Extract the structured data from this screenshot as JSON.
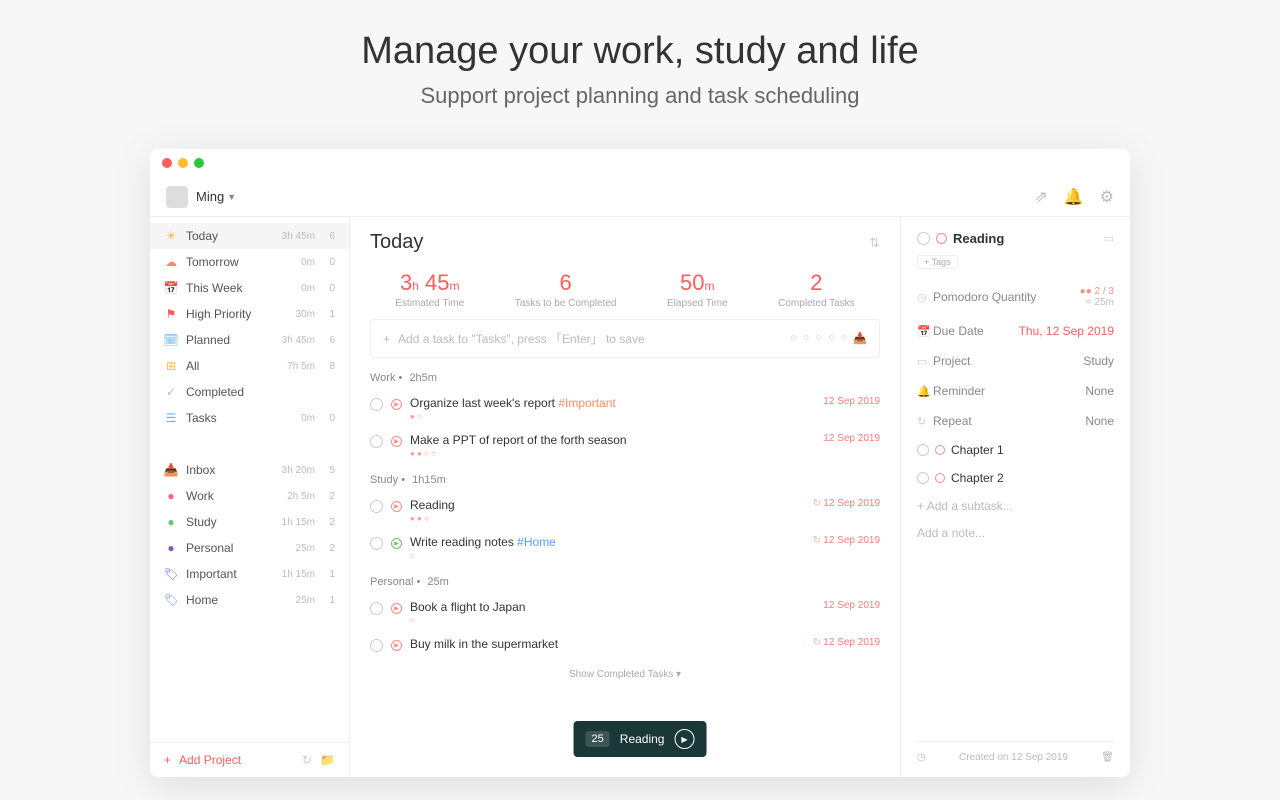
{
  "hero": {
    "title": "Manage your work, study and life",
    "subtitle": "Support project planning and task scheduling"
  },
  "topbar": {
    "username": "Ming"
  },
  "sidebar": {
    "smart": [
      {
        "icon": "☀",
        "color": "#ffb74d",
        "label": "Today",
        "meta": "3h 45m",
        "count": "6",
        "active": true
      },
      {
        "icon": "☁",
        "color": "#ff8a65",
        "label": "Tomorrow",
        "meta": "0m",
        "count": "0"
      },
      {
        "icon": "📅",
        "color": "#7986cb",
        "label": "This Week",
        "meta": "0m",
        "count": "0"
      },
      {
        "icon": "⚑",
        "color": "#ff5b5b",
        "label": "High Priority",
        "meta": "30m",
        "count": "1"
      },
      {
        "icon": "🗓",
        "color": "#64b5f6",
        "label": "Planned",
        "meta": "3h 45m",
        "count": "6"
      },
      {
        "icon": "⊞",
        "color": "#ffb74d",
        "label": "All",
        "meta": "7h 5m",
        "count": "8"
      },
      {
        "icon": "✓",
        "color": "#bbb",
        "label": "Completed",
        "meta": "",
        "count": ""
      },
      {
        "icon": "☰",
        "color": "#64b5f6",
        "label": "Tasks",
        "meta": "0m",
        "count": "0"
      }
    ],
    "projects": [
      {
        "icon": "📥",
        "color": "#bbb",
        "label": "Inbox",
        "meta": "3h 20m",
        "count": "5"
      },
      {
        "icon": "●",
        "color": "#ff5b8b",
        "label": "Work",
        "meta": "2h 5m",
        "count": "2"
      },
      {
        "icon": "●",
        "color": "#6bc46b",
        "label": "Study",
        "meta": "1h 15m",
        "count": "2"
      },
      {
        "icon": "●",
        "color": "#8b5bb0",
        "label": "Personal",
        "meta": "25m",
        "count": "2"
      },
      {
        "icon": "🏷",
        "color": "#8b5bff",
        "label": "Important",
        "meta": "1h 15m",
        "count": "1"
      },
      {
        "icon": "🏷",
        "color": "#5b9bff",
        "label": "Home",
        "meta": "25m",
        "count": "1"
      }
    ],
    "addProject": "Add Project"
  },
  "center": {
    "title": "Today",
    "stats": [
      {
        "value": "3",
        "sub": "h",
        "value2": "45",
        "sub2": "m",
        "label": "Estimated Time"
      },
      {
        "value": "6",
        "sub": "",
        "label": "Tasks to be Completed"
      },
      {
        "value": "50",
        "sub": "m",
        "label": "Elapsed Time"
      },
      {
        "value": "2",
        "sub": "",
        "label": "Completed Tasks"
      }
    ],
    "addPlaceholder": "Add a task to \"Tasks\", press 「Enter」 to save",
    "groups": [
      {
        "name": "Work",
        "duration": "2h5m",
        "tasks": [
          {
            "title": "Organize last week's report ",
            "tag": "#Important",
            "tagClass": "",
            "dots": "● ○",
            "date": "12 Sep 2019",
            "play": "red"
          },
          {
            "title": "Make a PPT of report of the forth season",
            "tag": "",
            "dots": "● ● ○ ○",
            "date": "12 Sep 2019",
            "play": "red"
          }
        ]
      },
      {
        "name": "Study",
        "duration": "1h15m",
        "tasks": [
          {
            "title": "Reading",
            "tag": "",
            "dots": "● ● ○",
            "date": "12 Sep 2019",
            "repeat": true,
            "play": "red"
          },
          {
            "title": "Write reading notes ",
            "tag": "#Home",
            "tagClass": "home",
            "dots": "○",
            "date": "12 Sep 2019",
            "repeat": true,
            "play": "green"
          }
        ]
      },
      {
        "name": "Personal",
        "duration": "25m",
        "tasks": [
          {
            "title": "Book a flight to Japan",
            "tag": "",
            "dots": "○",
            "date": "12 Sep 2019",
            "play": "red"
          },
          {
            "title": "Buy milk in the supermarket",
            "tag": "",
            "dots": "",
            "date": "12 Sep 2019",
            "repeat": true,
            "play": "red"
          }
        ]
      }
    ],
    "showCompleted": "Show Completed Tasks ▾"
  },
  "detail": {
    "title": "Reading",
    "tagsLabel": "+ Tags",
    "rows": {
      "pomo": {
        "label": "Pomodoro Quantity",
        "value": "●● 2 / 3",
        "sub": "= 25m"
      },
      "due": {
        "label": "Due Date",
        "value": "Thu, 12 Sep 2019"
      },
      "project": {
        "label": "Project",
        "value": "Study"
      },
      "reminder": {
        "label": "Reminder",
        "value": "None"
      },
      "repeat": {
        "label": "Repeat",
        "value": "None"
      }
    },
    "subtasks": [
      "Chapter 1",
      "Chapter 2"
    ],
    "addSubtask": "Add a subtask...",
    "addNote": "Add a note...",
    "created": "Created on 12 Sep 2019"
  },
  "pomo": {
    "time": "25",
    "label": "Reading"
  }
}
